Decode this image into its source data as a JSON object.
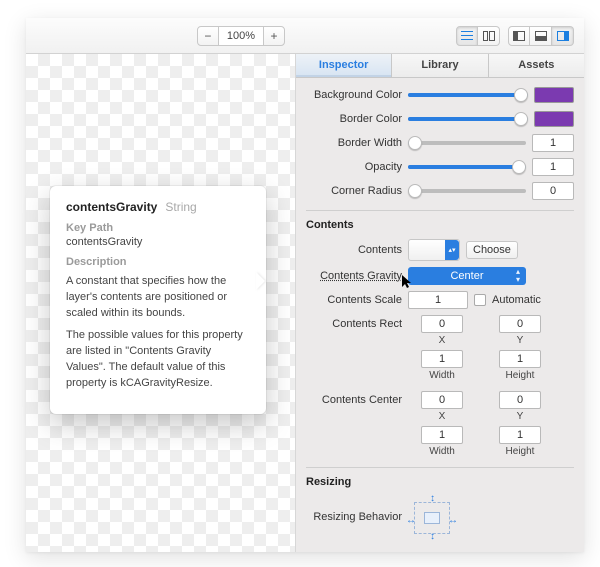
{
  "toolbar": {
    "zoom": "100%",
    "minus": "−",
    "plus": "+"
  },
  "tabs": {
    "inspector": "Inspector",
    "library": "Library",
    "assets": "Assets"
  },
  "props": {
    "backgroundColor": {
      "label": "Background Color",
      "swatch": "#7b3ab0"
    },
    "borderColor": {
      "label": "Border Color",
      "swatch": "#7b3ab0"
    },
    "borderWidth": {
      "label": "Border Width",
      "value": "1"
    },
    "opacity": {
      "label": "Opacity",
      "value": "1"
    },
    "cornerRadius": {
      "label": "Corner Radius",
      "value": "0"
    }
  },
  "sections": {
    "contents": "Contents",
    "resizing": "Resizing"
  },
  "contents": {
    "contentsLabel": "Contents",
    "choose": "Choose",
    "gravityLabel": "Contents Gravity",
    "gravityValue": "Center",
    "scaleLabel": "Contents Scale",
    "scaleValue": "1",
    "automatic": "Automatic",
    "rectLabel": "Contents Rect",
    "rect": {
      "x": "0",
      "y": "0",
      "w": "1",
      "h": "1"
    },
    "centerLabel": "Contents Center",
    "center": {
      "x": "0",
      "y": "0",
      "w": "1",
      "h": "1"
    },
    "axis": {
      "x": "X",
      "y": "Y",
      "w": "Width",
      "h": "Height"
    }
  },
  "resizing": {
    "behaviorLabel": "Resizing Behavior"
  },
  "popover": {
    "name": "contentsGravity",
    "type": "String",
    "keypathLabel": "Key Path",
    "keypath": "contentsGravity",
    "descLabel": "Description",
    "desc1": "A constant that specifies how the layer's contents are positioned or scaled within its bounds.",
    "desc2": "The possible values for this property are listed in \"Contents Gravity Values\". The default value of this property is kCAGravityResize."
  }
}
